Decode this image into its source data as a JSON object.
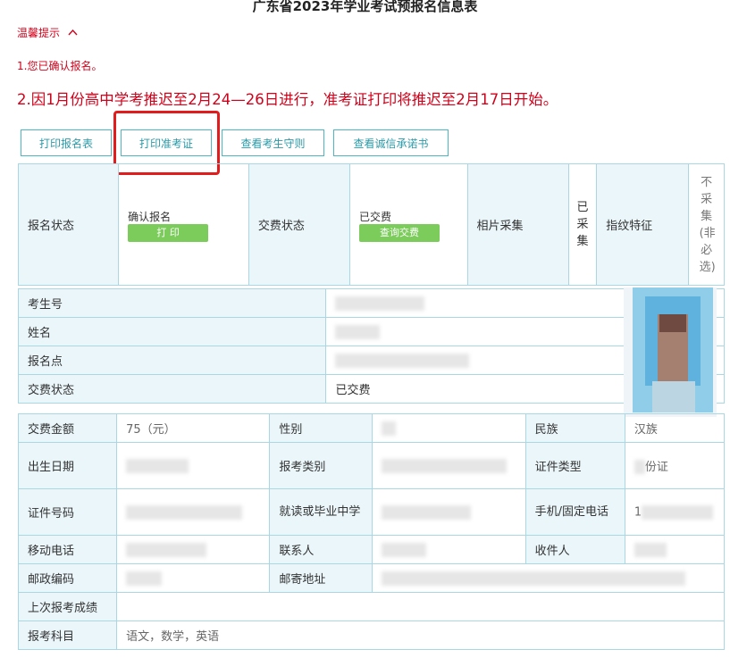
{
  "page_title": "广东省2023年学业考试预报名信息表",
  "tips": {
    "toggle_label": "温馨提示",
    "toggle_icon": "chevron-up-icon",
    "notice_1": "1.您已确认报名。",
    "notice_2": "2.因1月份高中学考推迟至2月24—26日进行，准考证打印将推迟至2月17日开始。"
  },
  "toolbar": {
    "print_registration": "打印报名表",
    "print_admission": "打印准考证",
    "view_rules": "查看考生守则",
    "view_pledge": "查看诚信承诺书"
  },
  "status_table": {
    "reg_status_label": "报名状态",
    "reg_status_value": "确认报名",
    "print_button": "打 印",
    "fee_status_label": "交费状态",
    "fee_status_value": "已交费",
    "query_fee_button": "查询交费",
    "photo_label": "相片采集",
    "photo_value": "已采集",
    "fingerprint_label": "指纹特征",
    "fingerprint_value": "不采集(非必选)"
  },
  "candidate": {
    "exam_no_label": "考生号",
    "name_label": "姓名",
    "site_label": "报名点",
    "fee_status_label": "交费状态",
    "fee_status_value": "已交费"
  },
  "details": {
    "fee_amount_label": "交费金额",
    "fee_amount_value": "75（元）",
    "gender_label": "性别",
    "ethnicity_label": "民族",
    "ethnicity_value": "汉族",
    "dob_label": "出生日期",
    "exam_type_label": "报考类别",
    "id_type_label": "证件类型",
    "id_type_value": "份证",
    "id_no_label": "证件号码",
    "school_label": "就读或毕业中学",
    "phone_label": "手机/固定电话",
    "phone_partial": "1",
    "mobile_label": "移动电话",
    "contact_label": "联系人",
    "recipient_label": "收件人",
    "postcode_label": "邮政编码",
    "address_label": "邮寄地址",
    "last_score_label": "上次报考成绩",
    "subjects_label": "报考科目",
    "subjects_value": "语文，数学，英语"
  },
  "colors": {
    "notice_red": "#d0021b",
    "border_teal": "#a9d8e4",
    "button_teal": "#4cb7c3",
    "green_button": "#7ccc5c",
    "highlight_red": "#e21c1c"
  }
}
